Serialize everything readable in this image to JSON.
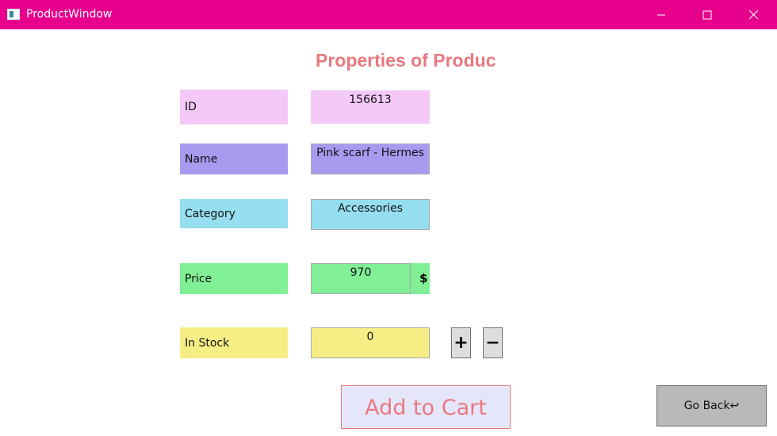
{
  "window": {
    "title": "ProductWindow",
    "icon": "app-window-icon",
    "controls": [
      "minimize-icon",
      "maximize-icon",
      "close-icon"
    ],
    "titlebar_color": "#e6008c"
  },
  "heading": "Properties of Produc",
  "fields": {
    "id": {
      "label": "ID",
      "value": "156613",
      "color": "#f4c9f8"
    },
    "name": {
      "label": "Name",
      "value": "Pink scarf - Hermes",
      "color": "#a99af0"
    },
    "category": {
      "label": "Category",
      "value": "Accessories",
      "color": "#95def0"
    },
    "price": {
      "label": "Price",
      "value": "970",
      "currency": "$",
      "color": "#80ef95"
    },
    "stock": {
      "label": "In Stock",
      "value": "0",
      "color": "#f6ee85"
    }
  },
  "stepper": {
    "plus": "+",
    "minus": "−"
  },
  "buttons": {
    "add_to_cart": "Add to Cart",
    "go_back": "Go Back↩"
  },
  "colors": {
    "heading": "#e8797f",
    "add_to_cart_bg": "#e6e6fa",
    "go_back_bg": "#b9b9b9"
  }
}
